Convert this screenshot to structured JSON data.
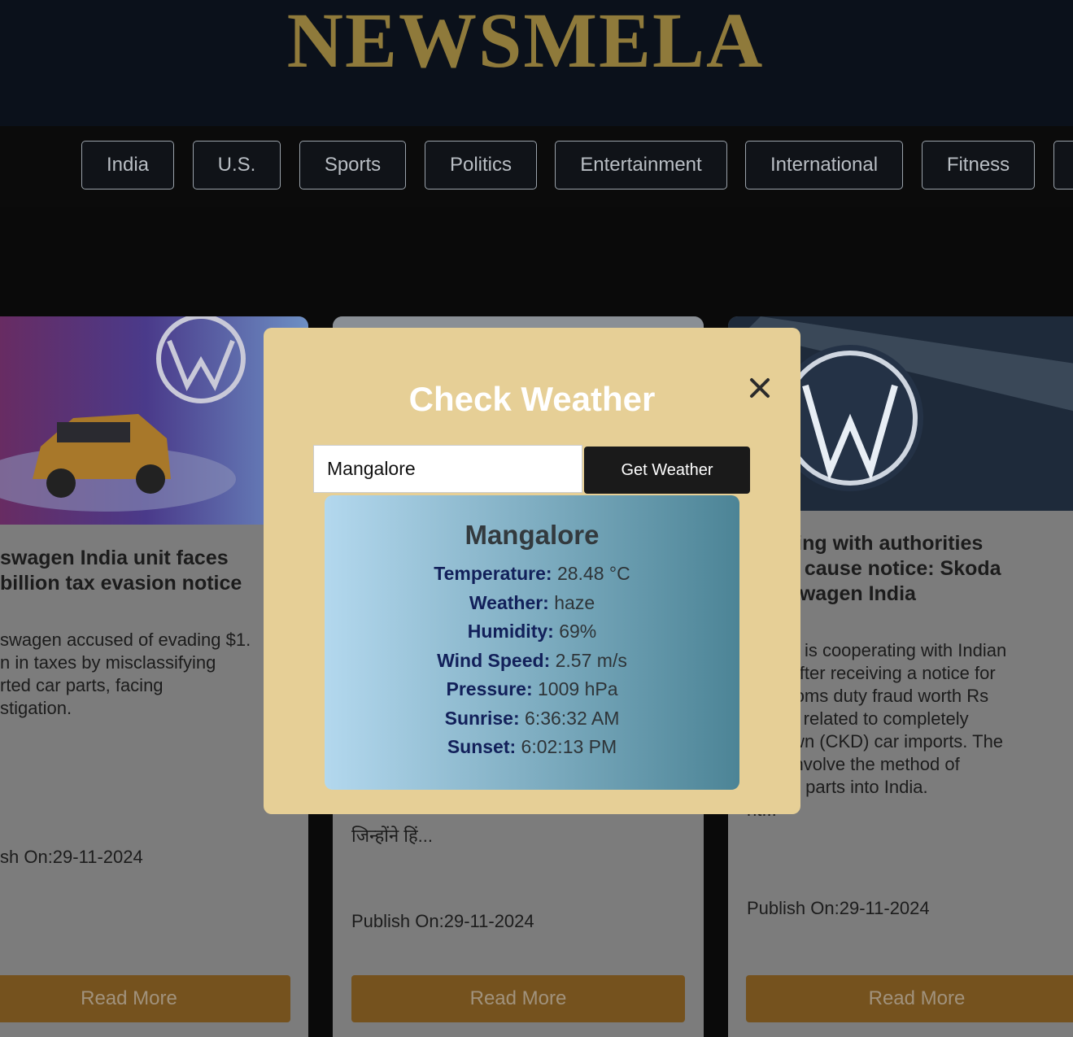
{
  "header": {
    "logo": "NEWSMELA"
  },
  "nav": {
    "items": [
      "India",
      "U.S.",
      "Sports",
      "Politics",
      "Entertainment",
      "International",
      "Fitness"
    ]
  },
  "cards": [
    {
      "title_lines": [
        "swagen India unit faces",
        "billion tax evasion notice"
      ],
      "desc_lines": [
        "swagen accused of evading $1.",
        "n in taxes by misclassifying",
        "rted car parts, facing",
        "stigation."
      ],
      "publish": "sh On:29-11-2024",
      "read_more": "Read More"
    },
    {
      "desc_lines": [
        "जिन्होंने हिं..."
      ],
      "publish": "Publish On:29-11-2024",
      "read_more": "Read More"
    },
    {
      "title_lines": [
        "perating with authorities",
        "show cause notice: Skoda",
        "Volkswagen India"
      ],
      "desc_lines": [
        "wagen is cooperating with Indian",
        "rities after receiving a notice for",
        "d customs duty fraud worth Rs",
        ") crore related to completely",
        "ed down (CKD) car imports. The",
        "tions involve the method of",
        "ing car parts into India.",
        "nt..."
      ],
      "publish": "Publish On:29-11-2024",
      "read_more": "Read More"
    }
  ],
  "modal": {
    "title": "Check Weather",
    "input_value": "Mangalore",
    "button_label": "Get Weather",
    "result": {
      "city": "Mangalore",
      "rows": [
        {
          "label": "Temperature:",
          "value": "28.48 °C"
        },
        {
          "label": "Weather:",
          "value": "haze"
        },
        {
          "label": "Humidity:",
          "value": "69%"
        },
        {
          "label": "Wind Speed:",
          "value": "2.57 m/s"
        },
        {
          "label": "Pressure:",
          "value": "1009 hPa"
        },
        {
          "label": "Sunrise:",
          "value": "6:36:32 AM"
        },
        {
          "label": "Sunset:",
          "value": "6:02:13 PM"
        }
      ]
    }
  },
  "colors": {
    "logo": "#8f7a3b",
    "modal_bg": "#e6cf96",
    "read_more_bg": "#75521e",
    "label_color": "#12205a"
  },
  "icons": {
    "close": "close-icon"
  }
}
